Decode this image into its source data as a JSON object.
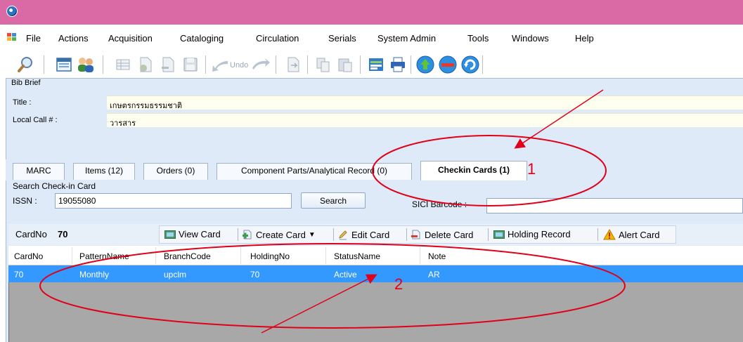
{
  "menu": {
    "items": [
      "File",
      "Actions",
      "Acquisition",
      "Cataloging",
      "Circulation",
      "Serials",
      "System Admin",
      "Tools",
      "Windows",
      "Help"
    ]
  },
  "toolbar": {
    "undo_label": "Undo",
    "icons": [
      "search-icon",
      "calendar-icon",
      "users-icon",
      "grid-icon",
      "add-page-icon",
      "remove-page-icon",
      "save-icon",
      "undo-icon",
      "redo-icon",
      "export-icon",
      "copy-icon",
      "paste-icon",
      "report-icon",
      "print-icon",
      "globe-up-icon",
      "globe-minus-icon",
      "globe-refresh-icon"
    ]
  },
  "bib_brief": {
    "legend": "Bib Brief",
    "title_label": "Title :",
    "title_value": "เกษตรกรรมธรรมชาติ",
    "call_label": "Local Call # :",
    "call_value": "วารสาร"
  },
  "tabs": [
    {
      "label": "MARC",
      "active": false
    },
    {
      "label": "Items (12)",
      "active": false
    },
    {
      "label": "Orders (0)",
      "active": false
    },
    {
      "label": "Component Parts/Analytical Record (0)",
      "active": false
    },
    {
      "label": "Checkin Cards (1)",
      "active": true
    }
  ],
  "search": {
    "legend": "Search Check-in Card",
    "issn_label": "ISSN :",
    "issn_value": "19055080",
    "search_button": "Search",
    "sici_label": "SICI Barcode :",
    "sici_value": ""
  },
  "card_bar": {
    "cardno_label": "CardNo",
    "cardno_value": "70",
    "view_card": "View Card",
    "create_card": "Create Card",
    "edit_card": "Edit Card",
    "delete_card": "Delete Card",
    "holding_record": "Holding Record",
    "alert_card": "Alert Card"
  },
  "grid": {
    "columns": [
      "CardNo",
      "PatternName",
      "BranchCode",
      "HoldingNo",
      "StatusName",
      "Note"
    ],
    "rows": [
      [
        "70",
        "Monthly",
        "upclm",
        "70",
        "Active",
        "AR"
      ]
    ]
  },
  "annotations": {
    "marker_1": "1",
    "marker_2": "2",
    "color": "#e0001a"
  },
  "colors": {
    "titlebar": "#d96aa5",
    "panel": "#dfeaf8",
    "selected_row": "#3399ff",
    "grid_empty": "#a8a8a8"
  }
}
